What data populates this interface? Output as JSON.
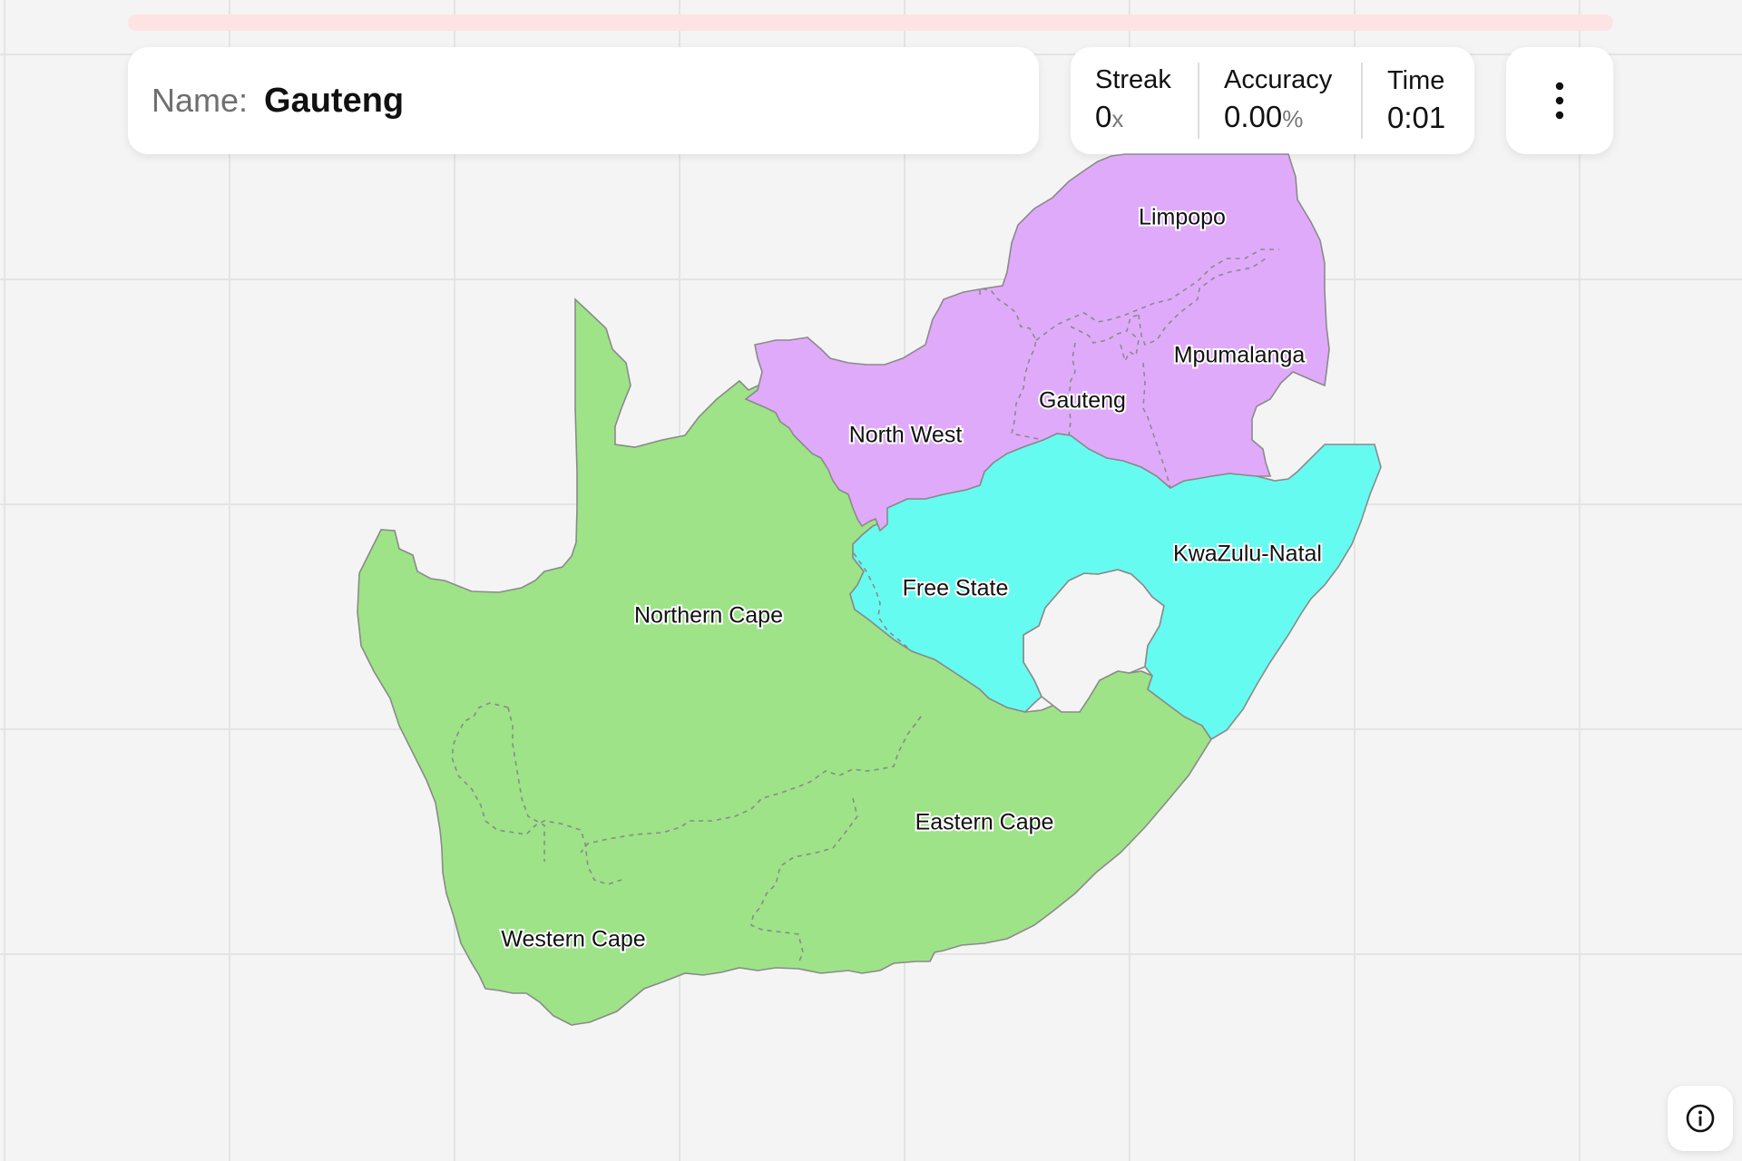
{
  "prompt": {
    "label": "Name:",
    "target": "Gauteng"
  },
  "progress": {
    "fraction": 0.0
  },
  "stats": {
    "streak": {
      "label": "Streak",
      "value": "0",
      "unit": "x"
    },
    "accuracy": {
      "label": "Accuracy",
      "value": "0.00",
      "unit": "%"
    },
    "time": {
      "label": "Time",
      "value": "0:01"
    }
  },
  "regions": {
    "limpopo": "Limpopo",
    "mpumalanga": "Mpumalanga",
    "gauteng": "Gauteng",
    "north_west": "North West",
    "free_state": "Free State",
    "kwazulu_natal": "KwaZulu-Natal",
    "northern_cape": "Northern Cape",
    "eastern_cape": "Eastern Cape",
    "western_cape": "Western Cape"
  },
  "colors": {
    "solved_group": "#e0aafa",
    "group_cyan": "#66fbf1",
    "group_green": "#9ee388",
    "progress_track": "#fde3e3"
  },
  "icons": {
    "menu": "kebab-vertical-icon",
    "info": "info-circle-icon"
  }
}
